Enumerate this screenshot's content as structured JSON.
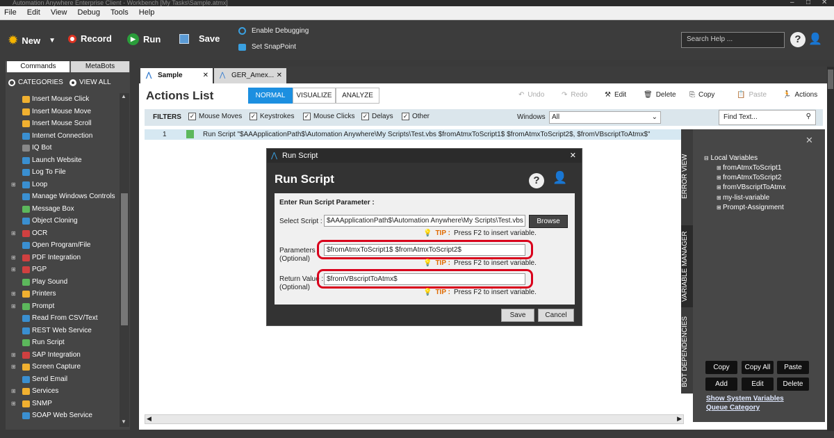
{
  "window": {
    "title": "Automation Anywhere Enterprise Client - Workbench [My Tasks\\Sample.atmx]"
  },
  "menu": [
    "File",
    "Edit",
    "View",
    "Debug",
    "Tools",
    "Help"
  ],
  "toolbar": {
    "new": "New",
    "record": "Record",
    "run": "Run",
    "save": "Save",
    "enable_debugging": "Enable Debugging",
    "set_snappoint": "Set SnapPoint",
    "search_placeholder": "Search Help ..."
  },
  "left_panel": {
    "tabs": [
      "Commands",
      "MetaBots"
    ],
    "categories_label": "CATEGORIES",
    "view_all_label": "VIEW ALL",
    "commands": [
      {
        "label": "Insert Mouse Click",
        "expand": false,
        "icon_color": "#f0b030"
      },
      {
        "label": "Insert Mouse Move",
        "expand": false,
        "icon_color": "#f0b030"
      },
      {
        "label": "Insert Mouse Scroll",
        "expand": false,
        "icon_color": "#f0b030"
      },
      {
        "label": "Internet Connection",
        "expand": false,
        "icon_color": "#3a8fd0"
      },
      {
        "label": "IQ Bot",
        "expand": false,
        "icon_color": "#888888"
      },
      {
        "label": "Launch Website",
        "expand": false,
        "icon_color": "#3a8fd0"
      },
      {
        "label": "Log To File",
        "expand": false,
        "icon_color": "#3a8fd0"
      },
      {
        "label": "Loop",
        "expand": true,
        "icon_color": "#3a8fd0"
      },
      {
        "label": "Manage Windows Controls",
        "expand": false,
        "icon_color": "#3a8fd0"
      },
      {
        "label": "Message Box",
        "expand": false,
        "icon_color": "#5cb85c"
      },
      {
        "label": "Object Cloning",
        "expand": false,
        "icon_color": "#3a8fd0"
      },
      {
        "label": "OCR",
        "expand": true,
        "icon_color": "#d04040"
      },
      {
        "label": "Open Program/File",
        "expand": false,
        "icon_color": "#3a8fd0"
      },
      {
        "label": "PDF Integration",
        "expand": true,
        "icon_color": "#d04040"
      },
      {
        "label": "PGP",
        "expand": true,
        "icon_color": "#d04040"
      },
      {
        "label": "Play Sound",
        "expand": false,
        "icon_color": "#5cb85c"
      },
      {
        "label": "Printers",
        "expand": true,
        "icon_color": "#f0b030"
      },
      {
        "label": "Prompt",
        "expand": true,
        "icon_color": "#5cb85c"
      },
      {
        "label": "Read From CSV/Text",
        "expand": false,
        "icon_color": "#3a8fd0"
      },
      {
        "label": "REST Web Service",
        "expand": false,
        "icon_color": "#3a8fd0"
      },
      {
        "label": "Run Script",
        "expand": false,
        "icon_color": "#5cb85c"
      },
      {
        "label": "SAP Integration",
        "expand": true,
        "icon_color": "#d04040"
      },
      {
        "label": "Screen Capture",
        "expand": true,
        "icon_color": "#f0b030"
      },
      {
        "label": "Send Email",
        "expand": false,
        "icon_color": "#3a8fd0"
      },
      {
        "label": "Services",
        "expand": true,
        "icon_color": "#f0b030"
      },
      {
        "label": "SNMP",
        "expand": true,
        "icon_color": "#f0b030"
      },
      {
        "label": "SOAP Web Service",
        "expand": false,
        "icon_color": "#3a8fd0"
      }
    ]
  },
  "doc_tabs": [
    {
      "label": "Sample",
      "active": true
    },
    {
      "label": "GER_Amex...",
      "active": false
    }
  ],
  "main": {
    "title": "Actions List",
    "modes": [
      "NORMAL",
      "VISUALIZE",
      "ANALYZE"
    ],
    "actions": [
      "Undo",
      "Redo",
      "Edit",
      "Delete",
      "Copy",
      "Paste",
      "Actions"
    ],
    "filters_label": "FILTERS",
    "filters": [
      "Mouse Moves",
      "Keystrokes",
      "Mouse Clicks",
      "Delays",
      "Other"
    ],
    "windows_label": "Windows",
    "windows_value": "All",
    "find_placeholder": "Find Text...",
    "line_number": "1",
    "line_text": "Run Script \"$AAApplicationPath$\\Automation Anywhere\\My Scripts\\Test.vbs $fromAtmxToScript1$ $fromAtmxToScript2$, $fromVBscriptToAtmx$\""
  },
  "right_panel": {
    "vtabs": [
      "ERROR VIEW",
      "VARIABLE MANAGER",
      "BOT DEPENDENCIES"
    ],
    "root": "Local Variables",
    "variables": [
      "fromAtmxToScript1",
      "fromAtmxToScript2",
      "fromVBscriptToAtmx",
      "my-list-variable",
      "Prompt-Assignment"
    ],
    "buttons_row1": [
      "Copy",
      "Copy All",
      "Paste"
    ],
    "buttons_row2": [
      "Add",
      "Edit",
      "Delete"
    ],
    "links": [
      "Show System Variables",
      "Queue Category"
    ]
  },
  "dialog": {
    "title": "Run Script",
    "heading": "Run Script",
    "section": "Enter Run Script Parameter :",
    "select_script_label": "Select Script :",
    "select_script_value": "$AAApplicationPath$\\Automation Anywhere\\My Scripts\\Test.vbs",
    "browse": "Browse",
    "tip_label": "TIP :",
    "tip_text": "Press F2 to insert variable.",
    "parameters_label": "Parameters :",
    "optional_label": "(Optional)",
    "parameters_value": "$fromAtmxToScript1$ $fromAtmxToScript2$",
    "return_label": "Return Value :",
    "return_value": "$fromVBscriptToAtmx$",
    "save": "Save",
    "cancel": "Cancel"
  }
}
